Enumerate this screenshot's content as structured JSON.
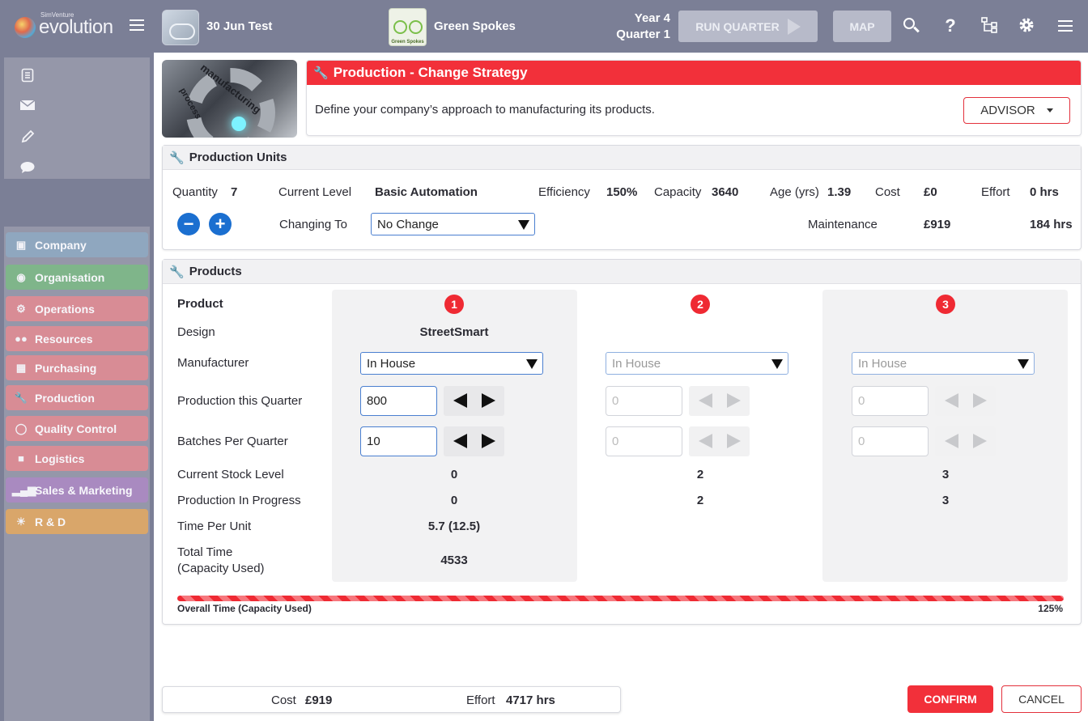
{
  "brand": {
    "small": "SimVenture",
    "name": "evolution"
  },
  "header": {
    "company_name": "30 Jun Test",
    "team_name": "Green Spokes",
    "team_logo_text": "Green Spokes",
    "year": "Year 4",
    "quarter": "Quarter 1",
    "run_quarter_label": "RUN QUARTER",
    "map_label": "MAP",
    "icons": [
      "search-icon",
      "help-icon",
      "org-chart-icon",
      "gear-icon",
      "menu-icon"
    ]
  },
  "sidebar": {
    "tools": [
      "clipboard-icon",
      "mail-icon",
      "pencil-icon",
      "chat-icon"
    ],
    "items": [
      {
        "label": "Company",
        "color": "#8fa7bf",
        "icon": "building-icon"
      },
      {
        "label": "Organisation",
        "color": "#7fb58a",
        "icon": "org-icon"
      },
      {
        "label": "Operations",
        "color": "#d88c95",
        "icon": "gears-icon"
      },
      {
        "label": "Resources",
        "color": "#d88c95",
        "icon": "people-icon"
      },
      {
        "label": "Purchasing",
        "color": "#d88c95",
        "icon": "boxes-icon"
      },
      {
        "label": "Production",
        "color": "#d88c95",
        "icon": "wrench-icon"
      },
      {
        "label": "Quality Control",
        "color": "#d88c95",
        "icon": "magnifier-check-icon"
      },
      {
        "label": "Logistics",
        "color": "#d88c95",
        "icon": "truck-icon"
      },
      {
        "label": "Sales & Marketing",
        "color": "#a98ac0",
        "icon": "bar-chart-icon"
      },
      {
        "label": "R & D",
        "color": "#d9a66a",
        "icon": "lightbulb-icon"
      }
    ]
  },
  "hero": {
    "caption_1": "manufacturing",
    "caption_2": "process"
  },
  "strategy": {
    "title": "Production - Change Strategy",
    "description": "Define your company’s approach to manufacturing its products.",
    "advisor_label": "ADVISOR"
  },
  "units": {
    "title": "Production Units",
    "quantity_label": "Quantity",
    "quantity": "7",
    "current_level_label": "Current Level",
    "current_level": "Basic Automation",
    "efficiency_label": "Efficiency",
    "efficiency": "150%",
    "capacity_label": "Capacity",
    "capacity": "3640",
    "age_label": "Age (yrs)",
    "age": "1.39",
    "cost_label": "Cost",
    "cost": "£0",
    "effort_label": "Effort",
    "effort": "0 hrs",
    "changing_to_label": "Changing To",
    "changing_to": "No Change",
    "maintenance_label": "Maintenance",
    "maintenance_cost": "£919",
    "maintenance_effort": "184 hrs",
    "minus": "−",
    "plus": "+"
  },
  "products": {
    "title": "Products",
    "row_labels": {
      "product": "Product",
      "design": "Design",
      "manufacturer": "Manufacturer",
      "production": "Production this Quarter",
      "batches": "Batches Per Quarter",
      "stock": "Current Stock Level",
      "in_progress": "Production In Progress",
      "time_per_unit": "Time Per Unit",
      "total_time_1": "Total Time",
      "total_time_2": "(Capacity Used)"
    },
    "columns": [
      {
        "number": "1",
        "design": "StreetSmart",
        "manufacturer": "In House",
        "production": "800",
        "batches": "10",
        "stock": "0",
        "in_progress": "0",
        "time_per_unit": "5.7 (12.5)",
        "total_time": "4533"
      },
      {
        "number": "2",
        "design": "",
        "manufacturer": "In House",
        "production": "0",
        "batches": "0",
        "stock": "2",
        "in_progress": "2",
        "time_per_unit": "",
        "total_time": ""
      },
      {
        "number": "3",
        "design": "",
        "manufacturer": "In House",
        "production": "0",
        "batches": "0",
        "stock": "3",
        "in_progress": "3",
        "time_per_unit": "",
        "total_time": ""
      }
    ],
    "overall_label": "Overall Time (Capacity Used)",
    "overall_pct": "125%",
    "overall_fraction": 1.25
  },
  "footer": {
    "cost_label": "Cost",
    "cost": "£919",
    "effort_label": "Effort",
    "effort": "4717 hrs",
    "confirm_label": "CONFIRM",
    "cancel_label": "CANCEL"
  }
}
